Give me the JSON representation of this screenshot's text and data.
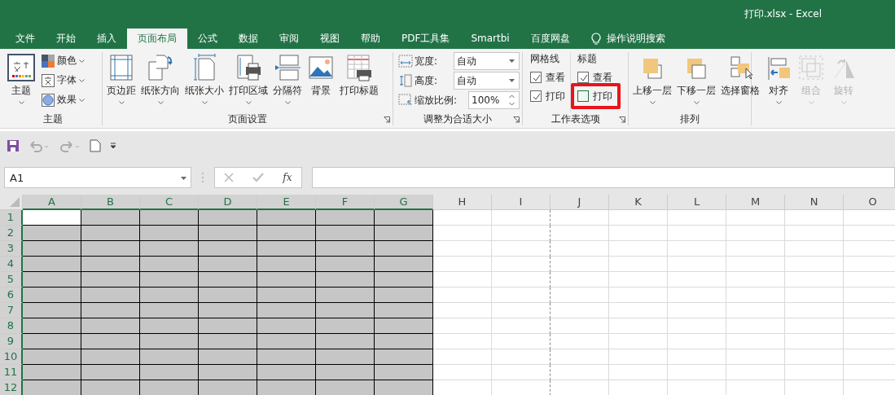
{
  "window": {
    "title": "打印.xlsx  -  Excel"
  },
  "tabs": [
    {
      "label": "文件",
      "selected": false,
      "kind": "tab"
    },
    {
      "label": "开始",
      "selected": false,
      "kind": "tab"
    },
    {
      "label": "插入",
      "selected": false,
      "kind": "tab"
    },
    {
      "label": "页面布局",
      "selected": true,
      "kind": "tab"
    },
    {
      "label": "公式",
      "selected": false,
      "kind": "tab"
    },
    {
      "label": "数据",
      "selected": false,
      "kind": "tab"
    },
    {
      "label": "审阅",
      "selected": false,
      "kind": "tab"
    },
    {
      "label": "视图",
      "selected": false,
      "kind": "tab"
    },
    {
      "label": "帮助",
      "selected": false,
      "kind": "tab"
    },
    {
      "label": "PDF工具集",
      "selected": false,
      "kind": "tab"
    },
    {
      "label": "Smartbi",
      "selected": false,
      "kind": "tab"
    },
    {
      "label": "百度网盘",
      "selected": false,
      "kind": "tab"
    },
    {
      "label": "操作说明搜索",
      "kind": "search"
    }
  ],
  "ribbon": {
    "theme": {
      "label": "主题",
      "main": {
        "label": "主题",
        "dropdown": true
      },
      "items": [
        {
          "label": "颜色"
        },
        {
          "label": "字体"
        },
        {
          "label": "效果"
        }
      ]
    },
    "page_setup": {
      "label": "页面设置",
      "launcher": true,
      "buttons": [
        {
          "label": "页边距",
          "dropdown": true
        },
        {
          "label": "纸张方向",
          "dropdown": true
        },
        {
          "label": "纸张大小",
          "dropdown": true
        },
        {
          "label": "打印区域",
          "dropdown": true
        },
        {
          "label": "分隔符",
          "dropdown": true
        },
        {
          "label": "背景",
          "dropdown": false
        },
        {
          "label": "打印标题",
          "dropdown": false
        }
      ]
    },
    "scale": {
      "label": "调整为合适大小",
      "launcher": true,
      "width": {
        "label": "宽度:",
        "value": "自动"
      },
      "height": {
        "label": "高度:",
        "value": "自动"
      },
      "ratio": {
        "label": "缩放比例:",
        "value": "100%"
      }
    },
    "sheet_options": {
      "label": "工作表选项",
      "launcher": true,
      "columns": [
        {
          "heading": "网格线",
          "view": {
            "label": "查看",
            "checked": true,
            "highlighted": false
          },
          "print": {
            "label": "打印",
            "checked": true,
            "highlighted": false
          }
        },
        {
          "heading": "标题",
          "view": {
            "label": "查看",
            "checked": true,
            "highlighted": false
          },
          "print": {
            "label": "打印",
            "checked": false,
            "highlighted": true
          }
        }
      ]
    },
    "arrange": {
      "label": "排列",
      "buttons": [
        {
          "label": "上移一层",
          "dropdown": true,
          "disabled": false
        },
        {
          "label": "下移一层",
          "dropdown": true,
          "disabled": false
        },
        {
          "label": "选择窗格",
          "dropdown": false,
          "disabled": false
        },
        {
          "label": "对齐",
          "dropdown": true,
          "disabled": false
        },
        {
          "label": "组合",
          "dropdown": true,
          "disabled": true
        },
        {
          "label": "旋转",
          "dropdown": true,
          "disabled": true
        }
      ]
    }
  },
  "formula_bar": {
    "name_box": "A1",
    "function_label": "fx"
  },
  "sheet": {
    "columns": [
      {
        "label": "A",
        "selected": true,
        "page_break": false
      },
      {
        "label": "B",
        "selected": true,
        "page_break": false
      },
      {
        "label": "C",
        "selected": true,
        "page_break": false
      },
      {
        "label": "D",
        "selected": true,
        "page_break": false
      },
      {
        "label": "E",
        "selected": true,
        "page_break": false
      },
      {
        "label": "F",
        "selected": true,
        "page_break": false
      },
      {
        "label": "G",
        "selected": true,
        "page_break": false
      },
      {
        "label": "H",
        "selected": false,
        "page_break": false
      },
      {
        "label": "I",
        "selected": false,
        "page_break": true
      },
      {
        "label": "J",
        "selected": false,
        "page_break": false
      },
      {
        "label": "K",
        "selected": false,
        "page_break": false
      },
      {
        "label": "L",
        "selected": false,
        "page_break": false
      },
      {
        "label": "M",
        "selected": false,
        "page_break": false
      },
      {
        "label": "N",
        "selected": false,
        "page_break": false
      },
      {
        "label": "O",
        "selected": false,
        "page_break": false
      }
    ],
    "rows": [
      {
        "label": "1",
        "selected": true
      },
      {
        "label": "2",
        "selected": true
      },
      {
        "label": "3",
        "selected": true
      },
      {
        "label": "4",
        "selected": true
      },
      {
        "label": "5",
        "selected": true
      },
      {
        "label": "6",
        "selected": true
      },
      {
        "label": "7",
        "selected": true
      },
      {
        "label": "8",
        "selected": true
      },
      {
        "label": "9",
        "selected": true
      },
      {
        "label": "10",
        "selected": true
      },
      {
        "label": "11",
        "selected": true
      },
      {
        "label": "12",
        "selected": true
      }
    ]
  }
}
